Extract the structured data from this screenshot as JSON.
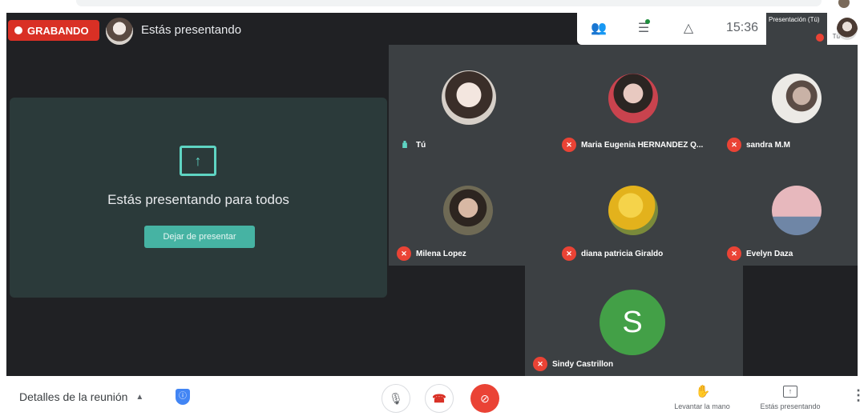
{
  "recording": {
    "label": "GRABANDO"
  },
  "header": {
    "presenting_status": "Estás presentando"
  },
  "top_right": {
    "clock": "15:36",
    "mini_presentation": {
      "label": "Presentación (Tú)",
      "self_label": "Tú"
    }
  },
  "presentation": {
    "message": "Estás presentando para todos",
    "stop_button": "Dejar de presentar"
  },
  "participants": [
    {
      "name": "Tú",
      "state": "speaking",
      "avatar_color": "#d6cfc8"
    },
    {
      "name": "Maria Eugenia HERNANDEZ Q...",
      "state": "muted",
      "avatar_color": "#c9434e"
    },
    {
      "name": "sandra M.M",
      "state": "muted",
      "avatar_color": "#eceae6"
    },
    {
      "name": "Milena Lopez",
      "state": "muted",
      "avatar_color": "#6f6a55"
    },
    {
      "name": "diana patricia Giraldo",
      "state": "muted",
      "avatar_color": "#e3b21c"
    },
    {
      "name": "Evelyn Daza",
      "state": "muted",
      "avatar_color": "#e7b8bd"
    },
    {
      "name": "Sindy Castrillon",
      "state": "muted",
      "avatar_letter": "S",
      "avatar_color": "#43a047"
    }
  ],
  "bottom_bar": {
    "meeting_details": "Detalles de la reunión",
    "raise_hand": "Levantar la mano",
    "presenting": "Estás presentando"
  },
  "colors": {
    "stage_bg": "#202124",
    "tile_bg": "#3c4043",
    "accent_teal": "#46b3a3",
    "mute_red": "#ea4335",
    "recording_red": "#d93025"
  },
  "icons": {
    "people": "people-icon",
    "chat": "chat-icon",
    "activities": "activities-icon",
    "present": "present-to-all-icon",
    "mic": "mic-icon",
    "hangup": "hang-up-icon",
    "camera_off": "camera-off-icon",
    "raise_hand": "hand-icon",
    "more": "more-vert-icon",
    "shield": "shield-icon"
  }
}
